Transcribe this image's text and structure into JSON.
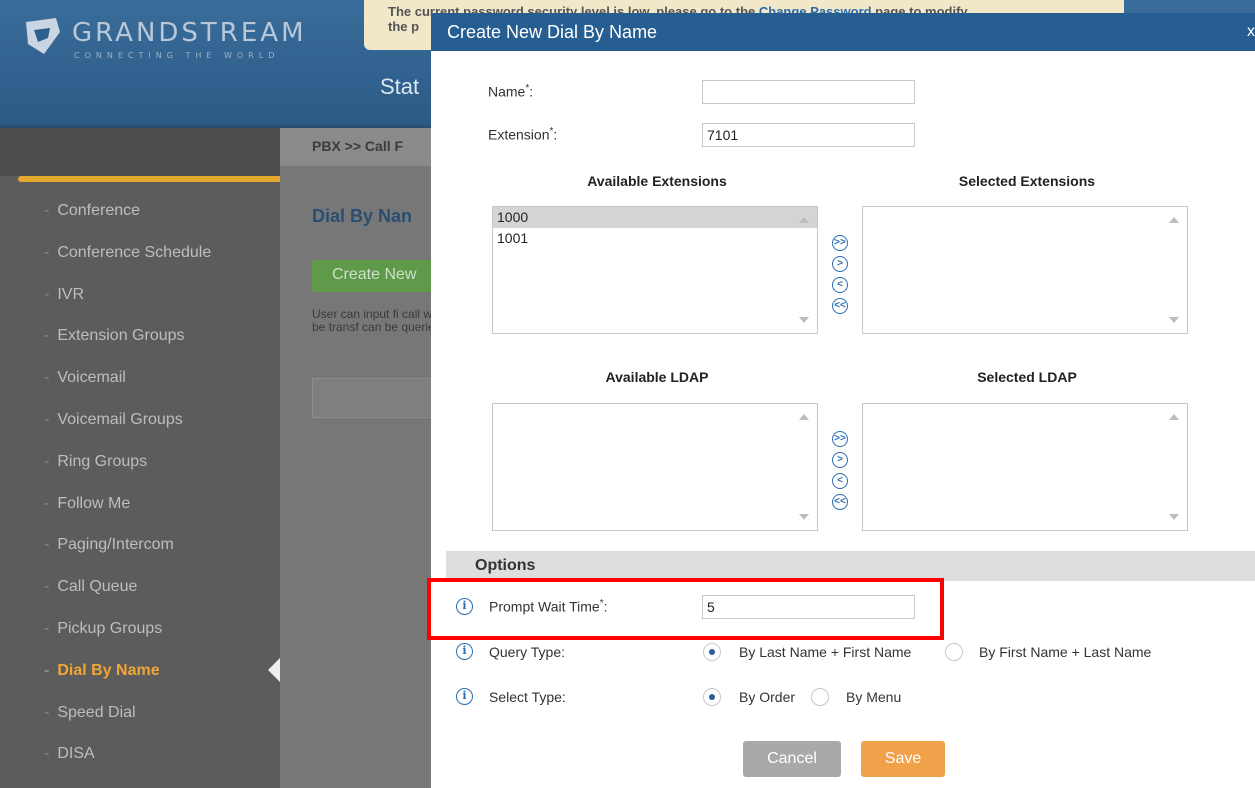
{
  "app": {
    "logo_text": "GRANDSTREAM",
    "logo_tagline": "CONNECTING THE WORLD",
    "warning_line1": "The current password security level is low, please go to the ",
    "warning_link": "Change Password",
    "warning_line1_end": " page to modify",
    "warning_line2": "the p",
    "header_title": "Stat"
  },
  "sidebar": {
    "items": [
      {
        "label": "Conference"
      },
      {
        "label": "Conference Schedule"
      },
      {
        "label": "IVR"
      },
      {
        "label": "Extension Groups"
      },
      {
        "label": "Voicemail"
      },
      {
        "label": "Voicemail Groups"
      },
      {
        "label": "Ring Groups"
      },
      {
        "label": "Follow Me"
      },
      {
        "label": "Paging/Intercom"
      },
      {
        "label": "Call Queue"
      },
      {
        "label": "Pickup Groups"
      },
      {
        "label": "Dial By Name"
      },
      {
        "label": "Speed Dial"
      },
      {
        "label": "DISA"
      }
    ],
    "active": "Dial By Name",
    "dash": "-"
  },
  "content": {
    "breadcrumb": "PBX >> Call F",
    "page_title": "Dial By Nan",
    "create_button": "Create New",
    "description": "User can input fi call will be transf can be queried b"
  },
  "modal": {
    "title": "Create New Dial By Name",
    "close": "x",
    "name_label": "Name",
    "name_value": "",
    "extension_label": "Extension",
    "extension_value": "7101",
    "required_mark": "*",
    "colon": ":",
    "available_extensions_title": "Available Extensions",
    "selected_extensions_title": "Selected Extensions",
    "available_extensions": [
      "1000",
      "1001"
    ],
    "selected_extensions": [],
    "available_ldap_title": "Available LDAP",
    "selected_ldap_title": "Selected LDAP",
    "available_ldap": [],
    "selected_ldap": [],
    "move_buttons": [
      ">>",
      ">",
      "<",
      "<<"
    ],
    "options_title": "Options",
    "prompt_wait_label": "Prompt Wait Time",
    "prompt_wait_value": "5",
    "query_type_label": "Query Type:",
    "query_type_options": [
      "By Last Name + First Name",
      "By First Name + Last Name"
    ],
    "query_type_selected": "By Last Name + First Name",
    "select_type_label": "Select Type:",
    "select_type_options": [
      "By Order",
      "By Menu"
    ],
    "select_type_selected": "By Order",
    "cancel_label": "Cancel",
    "save_label": "Save",
    "info_glyph": "i"
  },
  "colors": {
    "header_blue": "#275e91",
    "highlight": "#ff0000",
    "save_orange": "#f0a14a",
    "active_nav": "#f0a634"
  }
}
